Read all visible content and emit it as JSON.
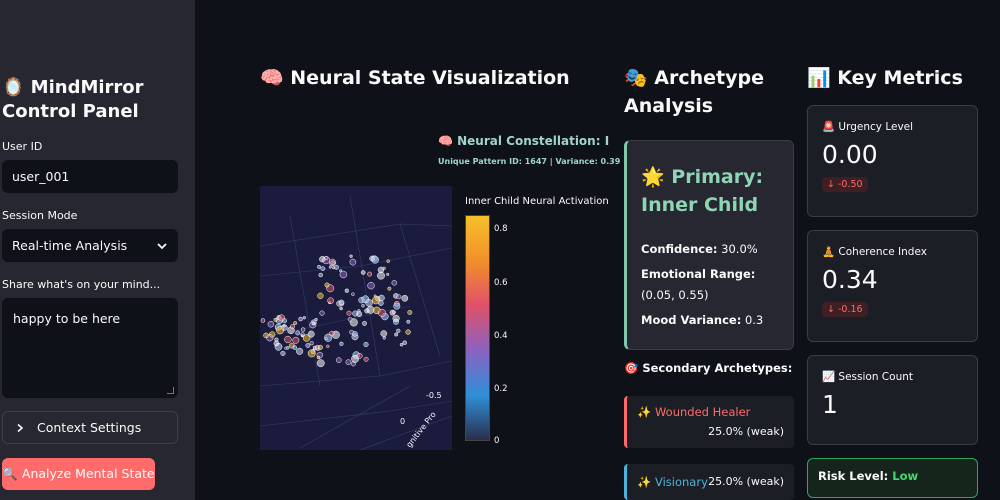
{
  "sidebar": {
    "title": "🪞 MindMirror Control Panel",
    "user_id_label": "User ID",
    "user_id_value": "user_001",
    "session_mode_label": "Session Mode",
    "session_mode_value": "Real-time Analysis",
    "share_label": "Share what's on your mind...",
    "share_value": "happy to be here",
    "context_settings_label": "Context Settings",
    "analyze_button_label": "🔍 Analyze Mental State"
  },
  "neural": {
    "heading": "🧠 Neural State Visualization",
    "plot_title": "🧠 Neural Constellation: Inner Child",
    "plot_subtitle": "Unique Pattern ID: 1647 | Variance: 0.39",
    "colorbar_title": "Inner Child Neural Activation",
    "colorbar_ticks": [
      "0.8",
      "0.6",
      "0.4",
      "0.2",
      "0"
    ],
    "axis_tick_a": "-0.5",
    "axis_tick_b": "0",
    "axis_label_fragment": "gnitive Pro"
  },
  "archetype": {
    "heading": "🎭 Archetype Analysis",
    "primary_label": "🌟 Primary: Inner Child",
    "confidence_label": "Confidence:",
    "confidence_value": "30.0%",
    "emotional_range_label": "Emotional Range:",
    "emotional_range_value": "(0.05, 0.55)",
    "mood_variance_label": "Mood Variance:",
    "mood_variance_value": "0.3",
    "secondary_heading": "🎯 Secondary Archetypes:",
    "secondary": [
      {
        "name": "✨ Wounded Healer",
        "pct": "25.0% (weak)",
        "color": "#ff6b6b"
      },
      {
        "name": "✨ Visionary",
        "pct": "25.0% (weak)",
        "color": "#4fb3d9"
      }
    ]
  },
  "metrics": {
    "heading": "📊 Key Metrics",
    "items": [
      {
        "label": "🚨 Urgency Level",
        "value": "0.00",
        "delta": "-0.50"
      },
      {
        "label": "🧘 Coherence Index",
        "value": "0.34",
        "delta": "-0.16"
      },
      {
        "label": "📈 Session Count",
        "value": "1",
        "delta": ""
      }
    ],
    "risk_label": "Risk Level:",
    "risk_value": "Low"
  },
  "colors": {
    "accent_red": "#ff6b6b",
    "accent_green": "#7fc8a9",
    "risk_green": "#3ddc72"
  }
}
